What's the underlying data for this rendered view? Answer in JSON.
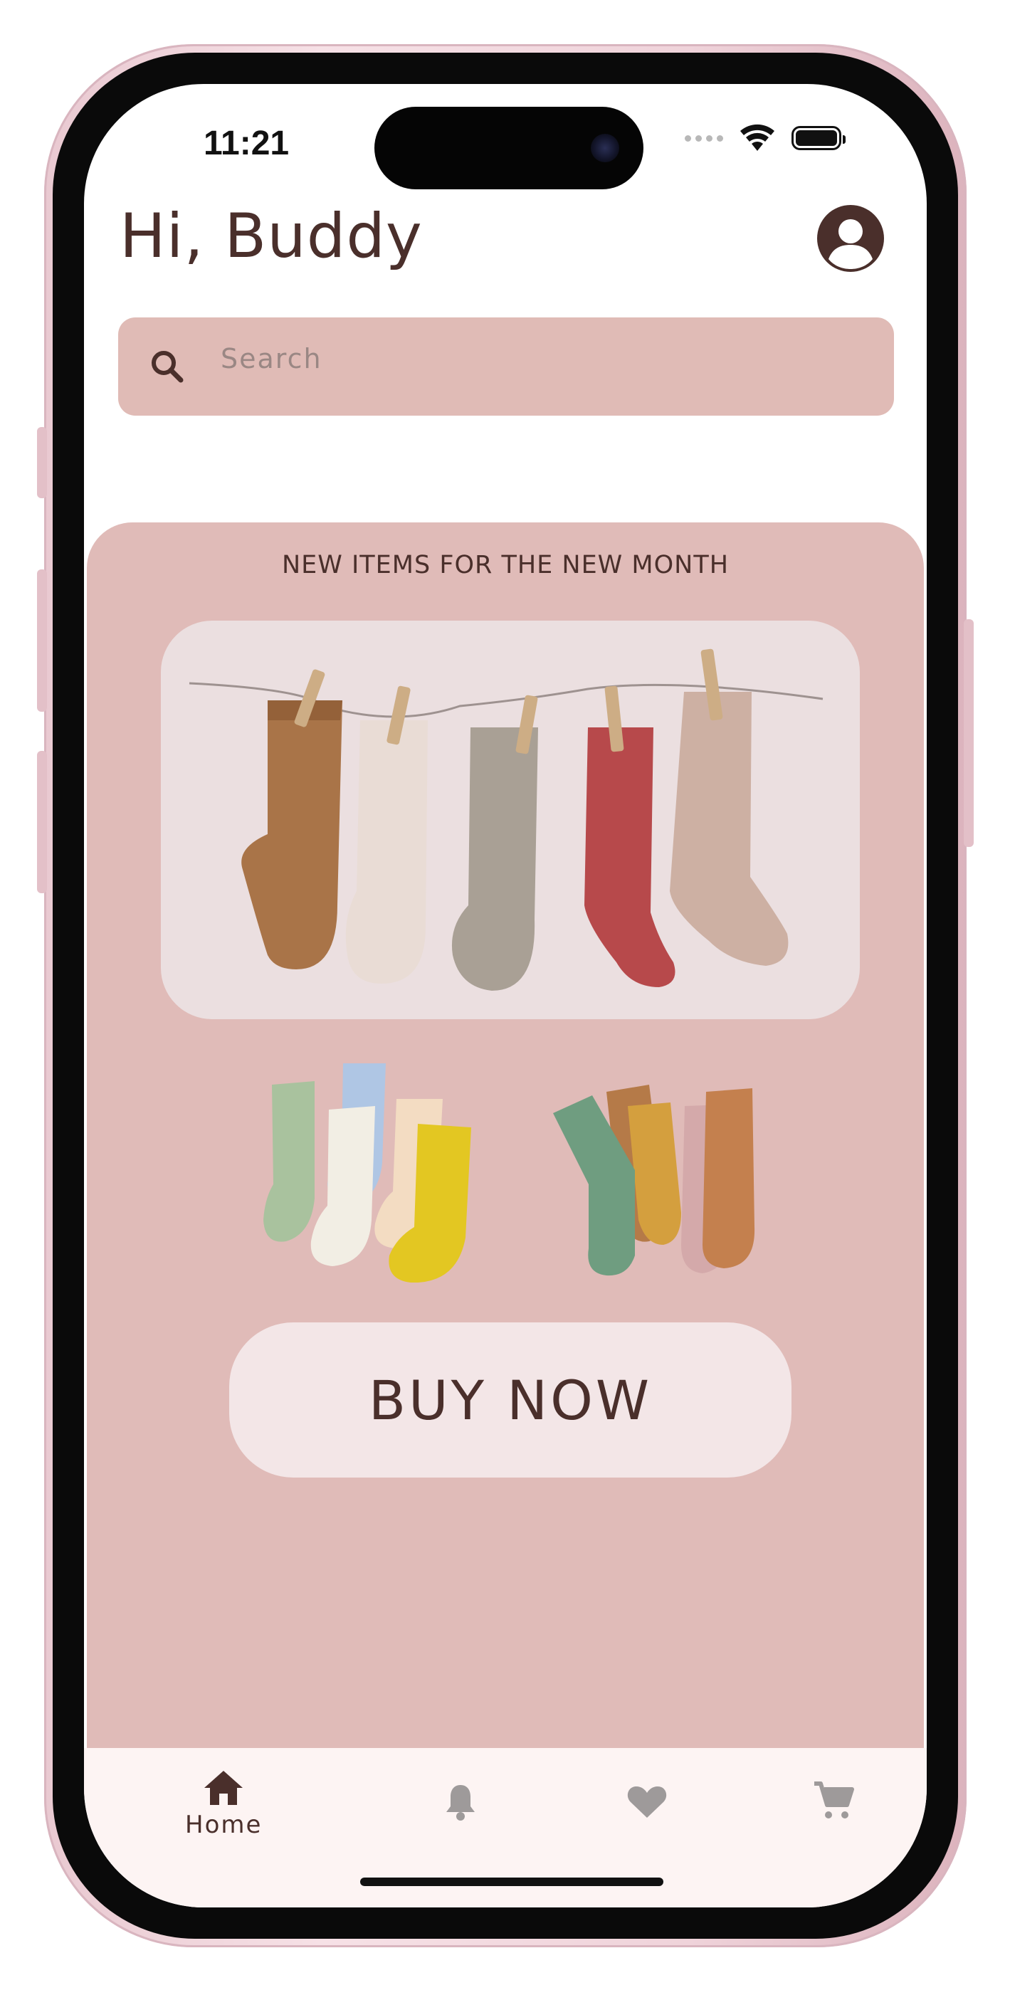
{
  "status_bar": {
    "time": "11:21"
  },
  "header": {
    "greeting": "Hi, Buddy",
    "avatar_icon": "account-circle-icon"
  },
  "search": {
    "placeholder": "Search",
    "icon": "search-icon"
  },
  "promo": {
    "title": "NEW ITEMS FOR THE NEW MONTH",
    "button_label": "BUY NOW",
    "background": "#e0bbb8"
  },
  "bottom_nav": {
    "items": [
      {
        "label": "Home",
        "icon": "home-icon",
        "active": true
      },
      {
        "label": "",
        "icon": "bell-icon",
        "active": false
      },
      {
        "label": "",
        "icon": "heart-icon",
        "active": false
      },
      {
        "label": "",
        "icon": "cart-icon",
        "active": false
      }
    ]
  },
  "colors": {
    "accent": "#4a2f2b",
    "search_bg": "#e0bbb6",
    "button_bg": "#f3e6e7",
    "nav_bg": "#fdf4f3"
  }
}
